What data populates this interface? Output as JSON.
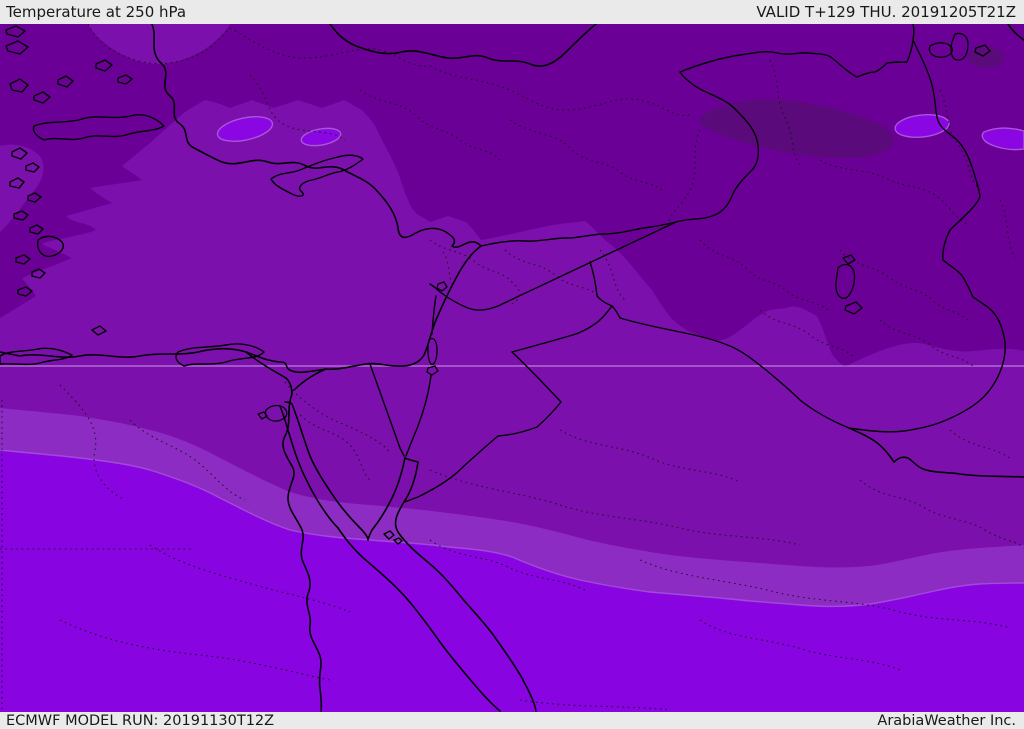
{
  "header": {
    "title": "Temperature at 250 hPa",
    "validity": "VALID T+129 THU. 20191205T21Z"
  },
  "footer": {
    "model_run": "ECMWF MODEL RUN: 20191130T12Z",
    "brand": "ArabiaWeather Inc."
  },
  "map": {
    "colors": {
      "band_darkest": "#5a0a7a",
      "band_dark": "#6a0095",
      "band_medium": "#7c10ad",
      "band_mauve": "#8d2cc3",
      "band_bright": "#8805e2",
      "warm_spot": "#8a06e3",
      "warm_spot_rim": "#a855d8",
      "border_line": "#000000",
      "admin_dotted": "#121212",
      "graticule": "#ecd9f7",
      "bar_background": "#eaeaea",
      "bar_text": "#191919"
    }
  }
}
